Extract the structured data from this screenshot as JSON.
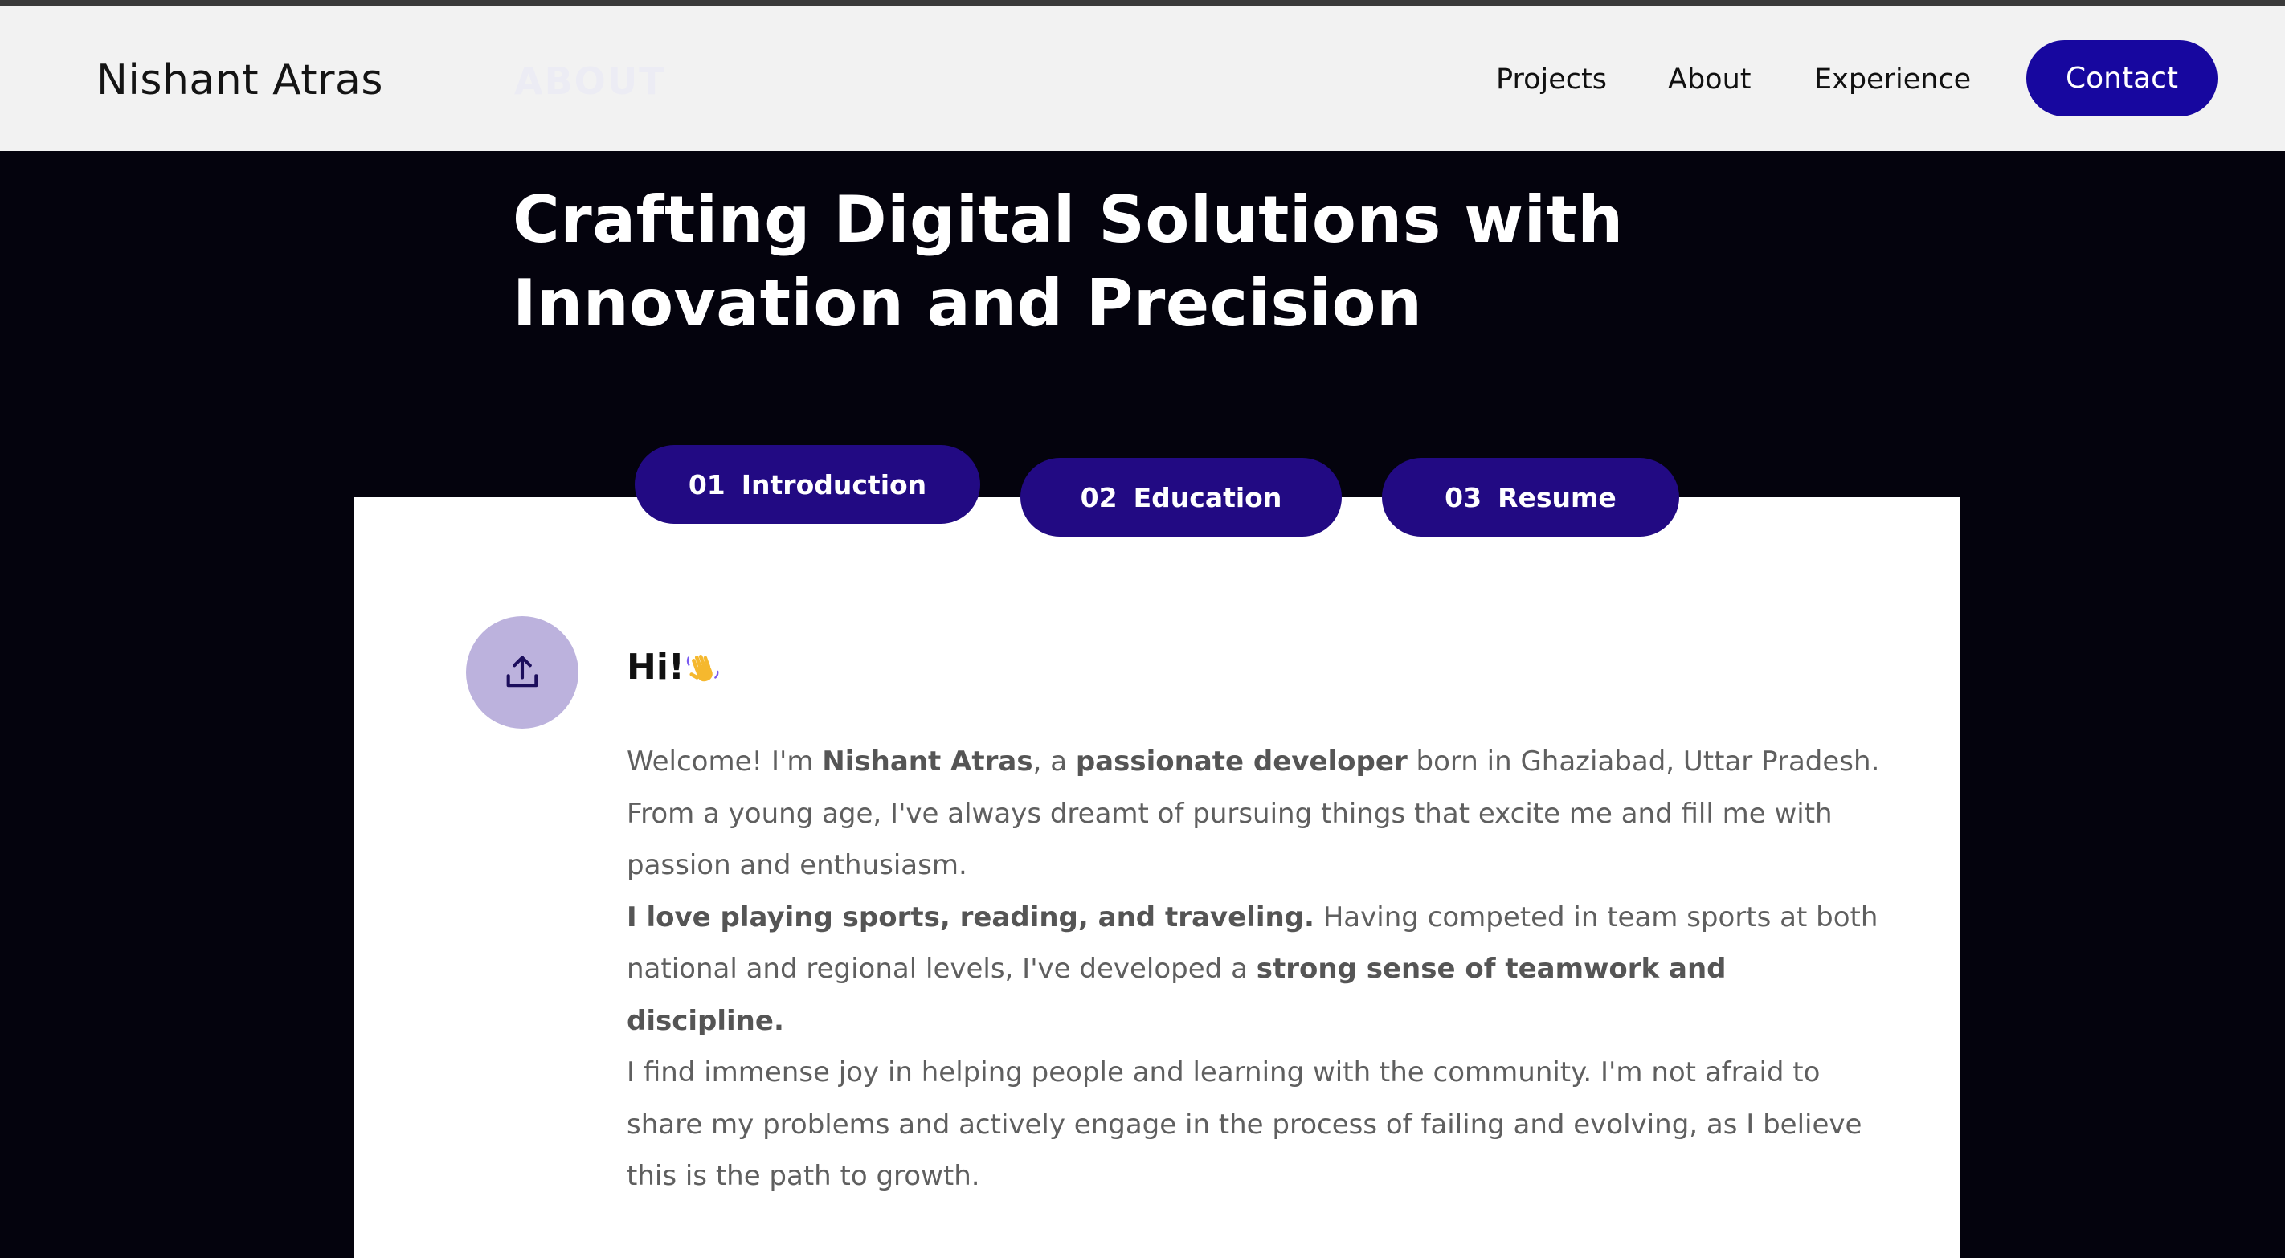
{
  "header": {
    "brand": "Nishant Atras",
    "section_label": "ABOUT",
    "nav": [
      "Projects",
      "About",
      "Experience"
    ],
    "cta": "Contact"
  },
  "hero": {
    "title_lines": [
      "Crafting Digital Solutions with",
      "Innovation and Precision"
    ]
  },
  "tabs": [
    {
      "num": "01",
      "label": "Introduction"
    },
    {
      "num": "02",
      "label": "Education"
    },
    {
      "num": "03",
      "label": "Resume"
    }
  ],
  "intro": {
    "icon": "upload-icon",
    "greeting": "Hi!",
    "greeting_emoji": "waving-hand-icon",
    "p1": {
      "t1": "Welcome! I'm ",
      "b1": "Nishant Atras",
      "t2": ", a ",
      "b2": "passionate developer",
      "t3": " born in Ghaziabad, Uttar Pradesh. From a young age, I've always dreamt of pursuing things that excite me and fill me with passion and enthusiasm."
    },
    "p2": {
      "b1": "I love playing sports, reading, and traveling.",
      "t1": " Having competed in team sports at both national and regional levels, I've developed a ",
      "b2": "strong sense of teamwork and discipline."
    },
    "p3": "I find immense joy in helping people and learning with the community. I'm not afraid to share my problems and actively engage in the process of failing and evolving, as I believe this is the path to growth."
  },
  "colors": {
    "page_bg": "#04030d",
    "nav_bg": "#f2f2f2",
    "cta_bg": "#17079f",
    "tab_bg": "#220a83",
    "icon_circle_bg": "#bcb2dd",
    "body_text": "#5f5f5f"
  }
}
